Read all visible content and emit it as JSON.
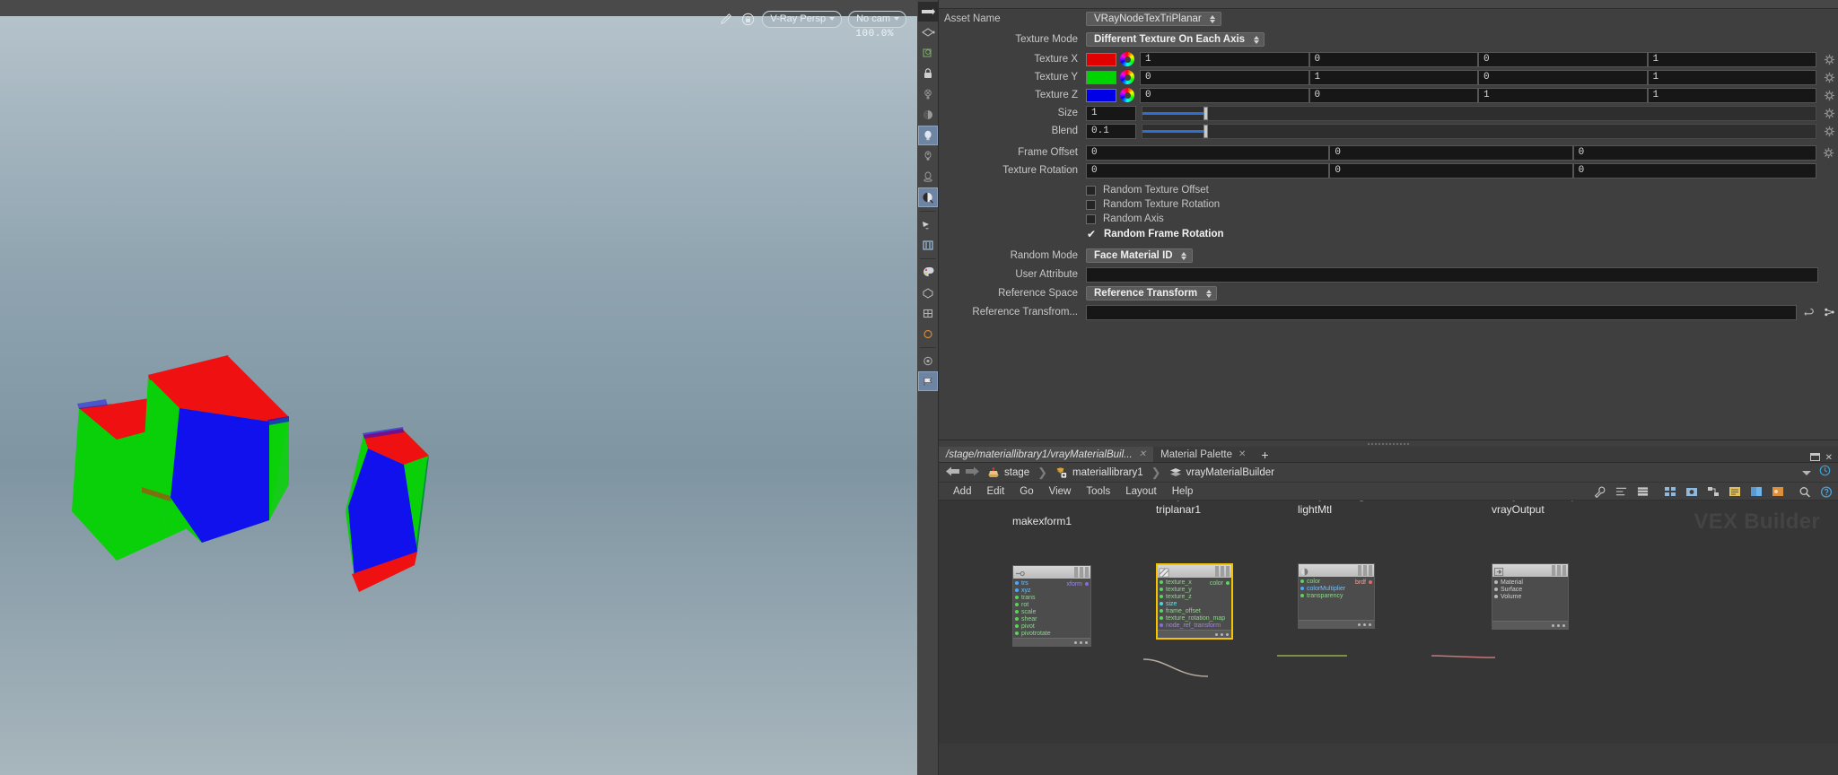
{
  "viewport": {
    "pencil_icon": "pencil-icon",
    "lock_icon": "lock-icon",
    "camera_mode": "V-Ray Persp",
    "camera_select": "No cam",
    "zoom_level": "100.0%",
    "background_top": "#b7c4cc",
    "background_bottom": "#8fa4b0"
  },
  "params": {
    "asset_name_label": "Asset Name",
    "asset_name_value": "VRayNodeTexTriPlanar",
    "texture_mode_label": "Texture Mode",
    "texture_mode_value": "Different Texture On Each Axis",
    "textures": [
      {
        "label": "Texture X",
        "color": "#e00000",
        "values": [
          "1",
          "0",
          "0",
          "1"
        ]
      },
      {
        "label": "Texture Y",
        "color": "#00d400",
        "values": [
          "0",
          "1",
          "0",
          "1"
        ]
      },
      {
        "label": "Texture Z",
        "color": "#0000e8",
        "values": [
          "0",
          "0",
          "1",
          "1"
        ]
      }
    ],
    "size_label": "Size",
    "size_value": "1",
    "size_slider_pct": 9,
    "blend_label": "Blend",
    "blend_value": "0.1",
    "blend_slider_pct": 9,
    "frame_offset_label": "Frame Offset",
    "frame_offset_values": [
      "0",
      "0",
      "0"
    ],
    "texture_rotation_label": "Texture Rotation",
    "texture_rotation_values": [
      "0",
      "0",
      "0"
    ],
    "checkboxes": [
      {
        "label": "Random Texture Offset",
        "checked": false
      },
      {
        "label": "Random Texture Rotation",
        "checked": false
      },
      {
        "label": "Random Axis",
        "checked": false
      },
      {
        "label": "Random Frame Rotation",
        "checked": true
      }
    ],
    "random_mode_label": "Random Mode",
    "random_mode_value": "Face Material ID",
    "user_attribute_label": "User Attribute",
    "user_attribute_value": "",
    "reference_space_label": "Reference Space",
    "reference_space_value": "Reference Transform",
    "reference_transform_label": "Reference Transfrom...",
    "reference_transform_value": ""
  },
  "network": {
    "tabs": [
      {
        "label": "/stage/materiallibrary1/vrayMaterialBuil...",
        "active": true
      },
      {
        "label": "Material Palette",
        "active": false
      }
    ],
    "add_tab_label": "+",
    "breadcrumbs": [
      {
        "label": "stage",
        "icon": "stage-icon"
      },
      {
        "label": "materiallibrary1",
        "icon": "material-library-icon"
      },
      {
        "label": "vrayMaterialBuilder",
        "icon": "layers-icon"
      }
    ],
    "menus": [
      "Add",
      "Edit",
      "Go",
      "View",
      "Tools",
      "Layout",
      "Help"
    ],
    "watermark": "VEX Builder",
    "nodes": [
      {
        "name": "makexform1",
        "type": "",
        "selected": false,
        "inputs": [
          {
            "label": "trs",
            "color": "#4aa8ff"
          },
          {
            "label": "xyz",
            "color": "#4aa8ff"
          },
          {
            "label": "trans",
            "color": "#5ad45a"
          },
          {
            "label": "rot",
            "color": "#5ad45a"
          },
          {
            "label": "scale",
            "color": "#5ad45a"
          },
          {
            "label": "shear",
            "color": "#5ad45a"
          },
          {
            "label": "pivot",
            "color": "#5ad45a"
          },
          {
            "label": "pivotrotate",
            "color": "#5ad45a"
          }
        ],
        "outputs": [
          {
            "label": "xform",
            "color": "#8a6adf"
          }
        ]
      },
      {
        "name": "triplanar1",
        "type": "V-Ray TexTriPlanar",
        "selected": true,
        "inputs": [
          {
            "label": "texture_x",
            "color": "#5ad45a"
          },
          {
            "label": "texture_y",
            "color": "#5ad45a"
          },
          {
            "label": "texture_z",
            "color": "#5ad45a"
          },
          {
            "label": "size",
            "color": "#4ad6d6"
          },
          {
            "label": "frame_offset",
            "color": "#5ad45a"
          },
          {
            "label": "texture_rotation_map",
            "color": "#5ad45a"
          },
          {
            "label": "node_ref_transform",
            "color": "#8a6adf"
          }
        ],
        "outputs": [
          {
            "label": "color",
            "color": "#5ad45a"
          }
        ]
      },
      {
        "name": "lightMtl",
        "type": "V-Ray BRDFLight",
        "selected": false,
        "inputs": [
          {
            "label": "color",
            "color": "#5ad45a"
          },
          {
            "label": "colorMultiplier",
            "color": "#4aa8ff"
          },
          {
            "label": "transparency",
            "color": "#5ad45a"
          }
        ],
        "outputs": [
          {
            "label": "brdf",
            "color": "#e06a6a"
          }
        ]
      },
      {
        "name": "vrayOutput",
        "type": "V-Ray Material Output",
        "selected": false,
        "inputs": [
          {
            "label": "Material",
            "color": "#d0d0d0"
          },
          {
            "label": "Surface",
            "color": "#d0d0d0"
          },
          {
            "label": "Volume",
            "color": "#d0d0d0"
          }
        ],
        "outputs": []
      }
    ]
  }
}
